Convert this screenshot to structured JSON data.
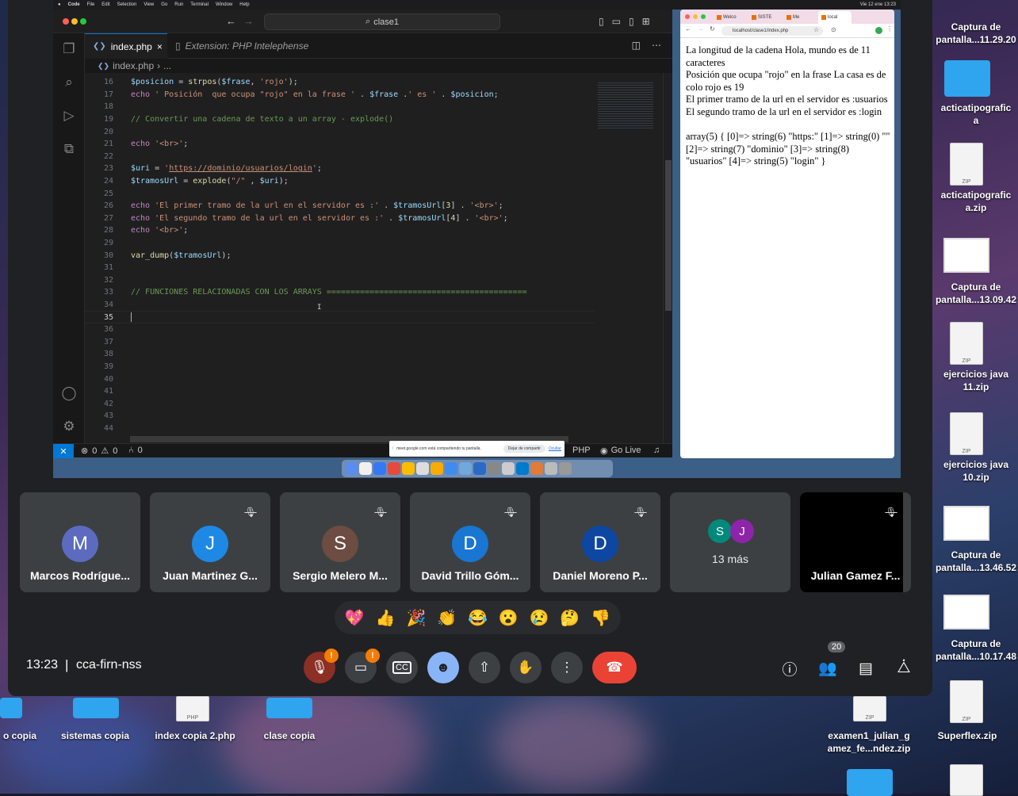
{
  "mac_menubar": {
    "items": [
      "Code",
      "File",
      "Edit",
      "Selection",
      "View",
      "Go",
      "Run",
      "Terminal",
      "Window",
      "Help"
    ],
    "clock": "Vie 12 ene 13:23"
  },
  "vscode": {
    "search": "clase1",
    "tabs": [
      {
        "label": "index.php",
        "active": true,
        "close": "×"
      },
      {
        "label": "Extension: PHP Intelephense",
        "active": false
      }
    ],
    "breadcrumb": [
      "index.php",
      "›",
      "..."
    ],
    "lines": [
      {
        "n": "16",
        "html": "<span class='v'>$posicion</span> = <span class='kw'>strpos</span>(<span class='v'>$frase</span>, <span class='s'>'rojo'</span>);"
      },
      {
        "n": "17",
        "html": "<span class='e'>echo</span> <span class='s'>' Posición  que ocupa \"rojo\" en la frase '</span> . <span class='v'>$frase</span> .<span class='s'>' es '</span> . <span class='v'>$posicion</span>;"
      },
      {
        "n": "18",
        "html": ""
      },
      {
        "n": "19",
        "html": "<span class='c'>// Convertir una cadena de texto a un array - explode()</span>"
      },
      {
        "n": "20",
        "html": ""
      },
      {
        "n": "21",
        "html": "<span class='e'>echo</span> <span class='s'>'&lt;br&gt;'</span>;"
      },
      {
        "n": "22",
        "html": ""
      },
      {
        "n": "23",
        "html": "<span class='v'>$uri</span> = <span class='s'>'</span><span class='url'>https://dominio/usuarios/login</span><span class='s'>'</span>;"
      },
      {
        "n": "24",
        "html": "<span class='v'>$tramosUrl</span> = <span class='kw'>explode</span>(<span class='s'>\"/\"</span> , <span class='v'>$uri</span>);"
      },
      {
        "n": "25",
        "html": ""
      },
      {
        "n": "26",
        "html": "<span class='e'>echo</span> <span class='s'>'El primer tramo de la url en el servidor es :'</span> . <span class='v'>$tramosUrl</span>[<span class='kw'>3</span>] . <span class='s'>'&lt;br&gt;'</span>;"
      },
      {
        "n": "27",
        "html": "<span class='e'>echo</span> <span class='s'>'El segundo tramo de la url en el servidor es :'</span> . <span class='v'>$tramosUrl</span>[<span class='kw'>4</span>] . <span class='s'>'&lt;br&gt;'</span>;"
      },
      {
        "n": "28",
        "html": "<span class='e'>echo</span> <span class='s'>'&lt;br&gt;'</span>;"
      },
      {
        "n": "29",
        "html": ""
      },
      {
        "n": "30",
        "html": "<span class='kw'>var_dump</span>(<span class='v'>$tramosUrl</span>);"
      },
      {
        "n": "31",
        "html": ""
      },
      {
        "n": "32",
        "html": ""
      },
      {
        "n": "33",
        "html": "<span class='c'>// FUNCIONES RELACIONADAS CON LOS ARRAYS ==========================================</span>"
      },
      {
        "n": "34",
        "html": ""
      },
      {
        "n": "35",
        "html": "",
        "active": true
      },
      {
        "n": "36",
        "html": ""
      },
      {
        "n": "37",
        "html": ""
      },
      {
        "n": "38",
        "html": ""
      },
      {
        "n": "39",
        "html": ""
      },
      {
        "n": "40",
        "html": ""
      },
      {
        "n": "41",
        "html": ""
      },
      {
        "n": "42",
        "html": ""
      },
      {
        "n": "43",
        "html": ""
      },
      {
        "n": "44",
        "html": ""
      }
    ],
    "status": {
      "errors": "0",
      "warnings": "0",
      "ports": "0",
      "language": "PHP",
      "golive": "Go Live"
    },
    "sharebar": {
      "message": "meet.google.com está compartiendo tu pantalla.",
      "stop": "Dejar de compartir",
      "hide": "Ocultar"
    }
  },
  "browser": {
    "tabs": [
      "Welco",
      "SISTE",
      "Me",
      "local"
    ],
    "url": "localhost/clase1/index.php",
    "content": [
      "La longitud de la cadena Hola, mundo es de 11 caracteres",
      "Posición que ocupa \"rojo\" en la frase La casa es de colo rojo es 19",
      "El primer tramo de la url en el servidor es :usuarios",
      "El segundo tramo de la url en el servidor es :login",
      "",
      "array(5) { [0]=> string(6) \"https:\" [1]=> string(0) \"\" [2]=> string(7) \"dominio\" [3]=> string(8) \"usuarios\" [4]=> string(5) \"login\" }"
    ]
  },
  "participants": [
    {
      "initial": "M",
      "name": "Marcos Rodrígue...",
      "color": "#5c6bc0",
      "muted": false
    },
    {
      "initial": "J",
      "name": "Juan Martinez G...",
      "color": "#1e88e5",
      "muted": true
    },
    {
      "initial": "S",
      "name": "Sergio Melero M...",
      "color": "#6d4c41",
      "muted": true
    },
    {
      "initial": "D",
      "name": "David Trillo Góm...",
      "color": "#1976d2",
      "muted": true
    },
    {
      "initial": "D",
      "name": "Daniel Moreno P...",
      "color": "#0d47a1",
      "muted": true
    }
  ],
  "more": {
    "label": "13 más",
    "initials": [
      "S",
      "J"
    ],
    "colors": [
      "#00897b",
      "#8e24aa"
    ]
  },
  "presenter": {
    "name": "Julian Gamez F..."
  },
  "reactions": [
    "💖",
    "👍",
    "🎉",
    "👏",
    "😂",
    "😮",
    "😢",
    "🤔",
    "👎"
  ],
  "meeting": {
    "time": "13:23",
    "separator": "|",
    "code": "cca-firn-nss",
    "people_count": "20",
    "alert": "!"
  },
  "desktop": {
    "right_icons": [
      "Captura de\npantalla...11.29.20",
      "acticatipografic\na",
      "acticatipografic\na.zip",
      "Captura de\npantalla...13.09.42",
      "ejercicios java\n11.zip",
      "ejercicios java\n10.zip",
      "Captura de\npantalla...13.46.52",
      "Captura de\npantalla...10.17.48"
    ],
    "bottom_icons": [
      "o copia",
      "sistemas copia",
      "index copia 2.php",
      "clase copia",
      "examen1_julian_g\namez_fe...ndez.zip",
      "Superflex.zip"
    ],
    "zip_label": "ZIP",
    "php_label": "PHP"
  }
}
